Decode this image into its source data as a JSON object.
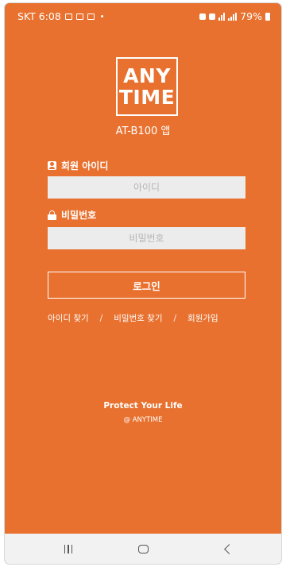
{
  "status_bar": {
    "carrier_time": "SKT 6:08",
    "battery": "79%",
    "left_icons": [
      "gallery-icon",
      "mail-icon",
      "calendar-icon"
    ],
    "right_icons": [
      "alarm-icon",
      "mute-icon",
      "wifi-icon",
      "signal-icon",
      "battery-icon"
    ]
  },
  "logo": {
    "line1": "ANY",
    "line2": "TIME"
  },
  "app_label": "AT-B100 앱",
  "form": {
    "id_label": "회원 아이디",
    "id_placeholder": "아이디",
    "id_value": "",
    "pw_label": "비밀번호",
    "pw_placeholder": "비밀번호",
    "pw_value": "",
    "login_button": "로그인"
  },
  "links": {
    "find_id": "아이디 찾기",
    "find_pw": "비밀번호 찾기",
    "signup": "회원가입",
    "separator": "/"
  },
  "footer": {
    "title": "Protect Your Life",
    "subtitle": "@ ANYTIME"
  },
  "nav_bar": {
    "buttons": [
      "recents-icon",
      "home-icon",
      "back-icon"
    ]
  },
  "colors": {
    "brand_orange": "#e8712f",
    "input_bg": "#ececec",
    "nav_bg": "#f2f2f2"
  }
}
